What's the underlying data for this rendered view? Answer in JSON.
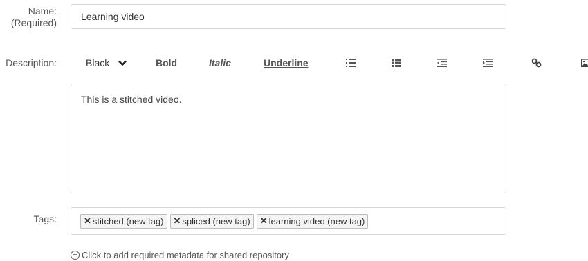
{
  "name": {
    "label": "Name:",
    "required": "(Required)",
    "value": "Learning video"
  },
  "description": {
    "label": "Description:",
    "toolbar": {
      "color": "Black",
      "bold": "Bold",
      "italic": "Italic",
      "underline": "Underline",
      "icons": [
        "bulleted-list-icon",
        "numbered-list-icon",
        "outdent-icon",
        "indent-icon",
        "link-icon",
        "image-icon"
      ]
    },
    "content": "This is a stitched video."
  },
  "tags": {
    "label": "Tags:",
    "items": [
      {
        "remove": "✕",
        "text": "stitched (new tag)"
      },
      {
        "remove": "✕",
        "text": "spliced (new tag)"
      },
      {
        "remove": "✕",
        "text": "learning video (new tag)"
      }
    ]
  },
  "metadata_link": {
    "icon": "+",
    "text": "Click to add required metadata for shared repository"
  }
}
